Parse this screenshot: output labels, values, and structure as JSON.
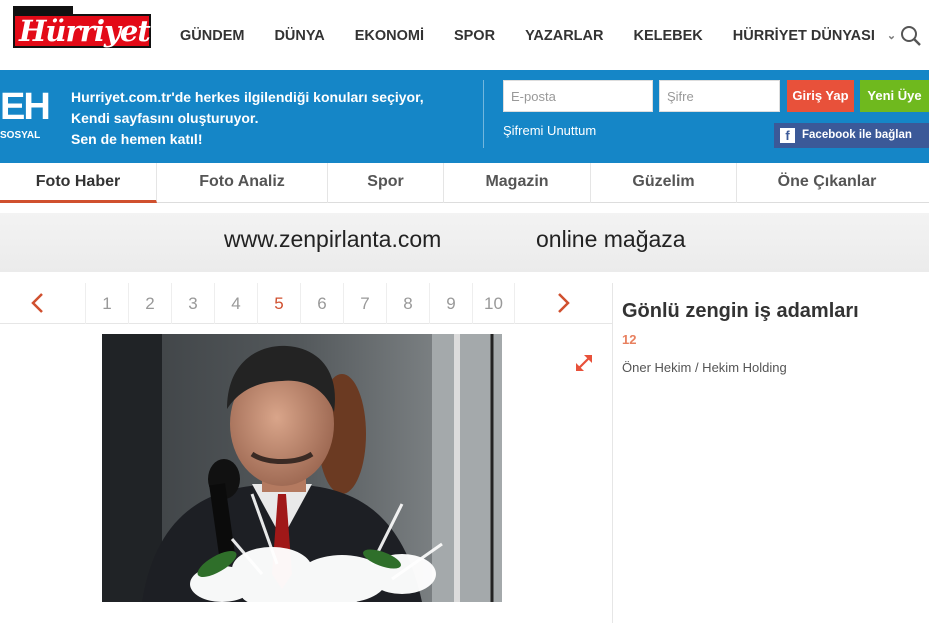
{
  "header": {
    "logo_text": "Hürriyet",
    "nav": [
      "GÜNDEM",
      "DÜNYA",
      "EKONOMİ",
      "SPOR",
      "YAZARLAR",
      "KELEBEK",
      "HÜRRİYET DÜNYASI"
    ],
    "search_icon": "search-icon"
  },
  "social_band": {
    "brand": "EH",
    "brand_sub": "SOSYAL",
    "promo_lines": [
      "Hurriyet.com.tr'de herkes ilgilendiği konuları seçiyor,",
      "Kendi sayfasını oluşturuyor.",
      "Sen de hemen katıl!"
    ],
    "email_placeholder": "E-posta",
    "password_placeholder": "Şifre",
    "login_label": "Giriş Yap",
    "signup_label": "Yeni Üye",
    "forgot_label": "Şifremi Unuttum",
    "facebook_label": "Facebook ile bağlan",
    "colors": {
      "band": "#1586c7",
      "login": "#e8513a",
      "signup": "#6fb91e",
      "facebook": "#3b5998"
    }
  },
  "tabs": [
    {
      "label": "Foto Haber",
      "active": true
    },
    {
      "label": "Foto Analiz",
      "active": false
    },
    {
      "label": "Spor",
      "active": false
    },
    {
      "label": "Magazin",
      "active": false
    },
    {
      "label": "Güzelim",
      "active": false
    },
    {
      "label": "Öne Çıkanlar",
      "active": false
    }
  ],
  "ad": {
    "url": "www.zenpirlanta.com",
    "tagline": "online mağaza"
  },
  "pager": {
    "pages": [
      "1",
      "2",
      "3",
      "4",
      "5",
      "6",
      "7",
      "8",
      "9",
      "10"
    ],
    "current": "5"
  },
  "gallery": {
    "title": "Gönlü zengin iş adamları",
    "count": "12",
    "caption": "Öner Hekim / Hekim Holding"
  }
}
